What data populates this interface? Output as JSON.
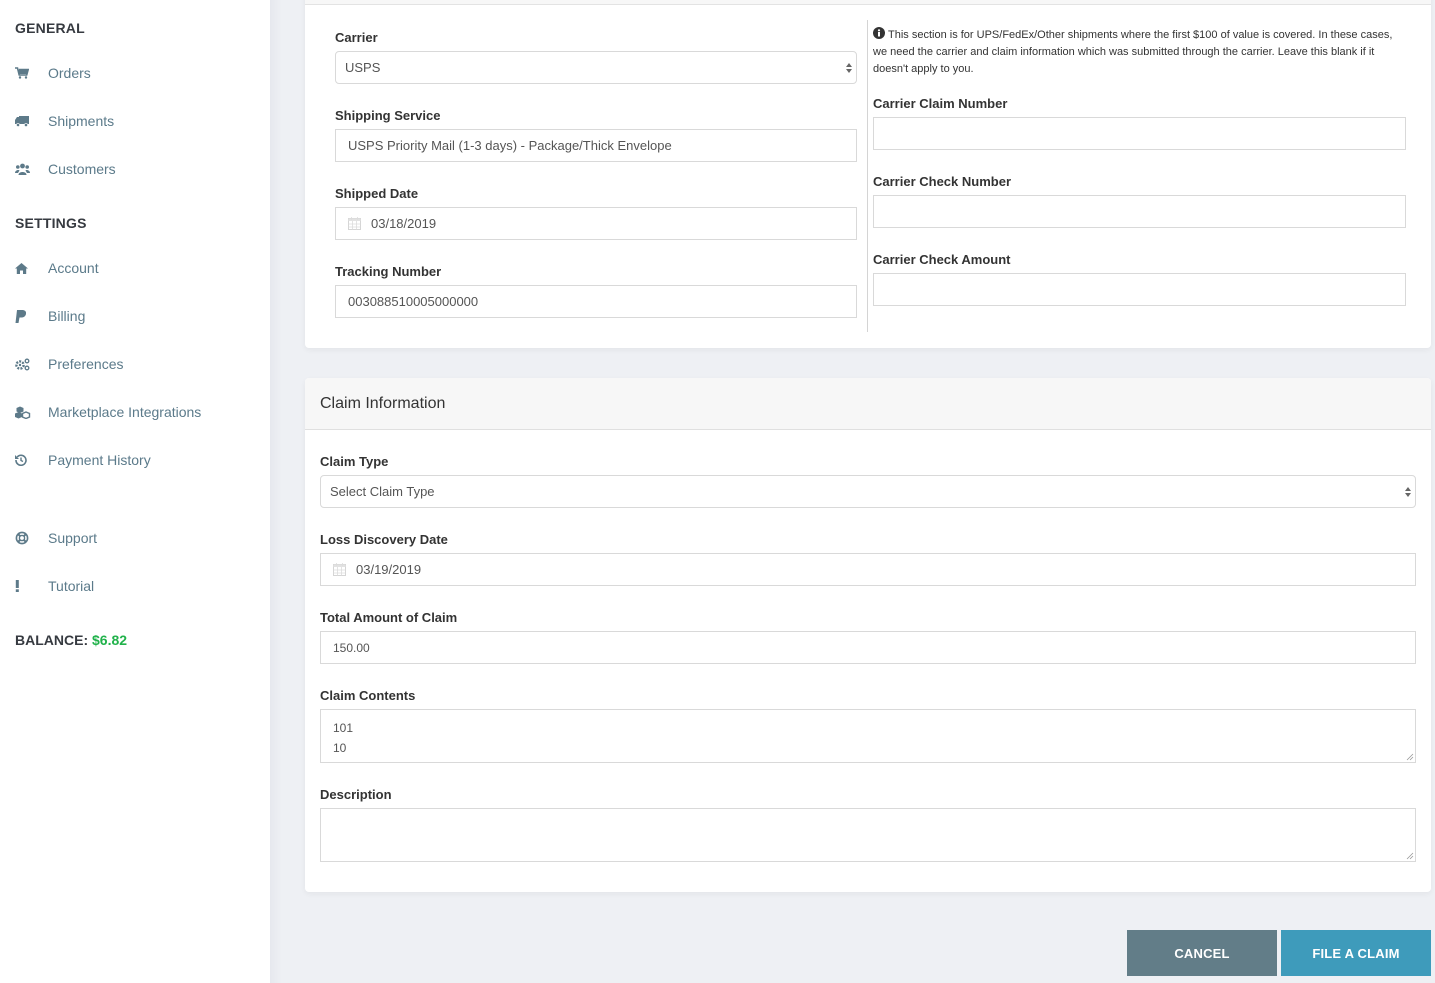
{
  "sidebar": {
    "general_heading": "GENERAL",
    "settings_heading": "SETTINGS",
    "general_items": [
      {
        "label": "Orders",
        "icon": "shopping-cart-icon"
      },
      {
        "label": "Shipments",
        "icon": "truck-icon"
      },
      {
        "label": "Customers",
        "icon": "users-icon"
      }
    ],
    "settings_items": [
      {
        "label": "Account",
        "icon": "home-icon"
      },
      {
        "label": "Billing",
        "icon": "paypal-icon"
      },
      {
        "label": "Preferences",
        "icon": "cogs-icon"
      },
      {
        "label": "Marketplace Integrations",
        "icon": "cubes-icon"
      },
      {
        "label": "Payment History",
        "icon": "history-icon"
      }
    ],
    "extra_items": [
      {
        "label": "Support",
        "icon": "life-ring-icon"
      },
      {
        "label": "Tutorial",
        "icon": "exclamation-icon"
      }
    ],
    "balance_label": "BALANCE:",
    "balance_value": "$6.82",
    "balance_color": "#21b24b"
  },
  "shipment": {
    "carrier": {
      "label": "Carrier",
      "value": "USPS"
    },
    "shipping_service": {
      "label": "Shipping Service",
      "value": "USPS Priority Mail (1-3 days) - Package/Thick Envelope"
    },
    "shipped_date": {
      "label": "Shipped Date",
      "value": "03/18/2019"
    },
    "tracking_number": {
      "label": "Tracking Number",
      "value": "003088510005000000"
    },
    "info_text": "This section is for UPS/FedEx/Other shipments where the first $100 of value is covered. In these cases, we need the carrier and claim information which was submitted through the carrier. Leave this blank if it doesn't apply to you.",
    "carrier_claim_number": {
      "label": "Carrier Claim Number",
      "value": ""
    },
    "carrier_check_number": {
      "label": "Carrier Check Number",
      "value": ""
    },
    "carrier_check_amount": {
      "label": "Carrier Check Amount",
      "value": ""
    }
  },
  "claim": {
    "title": "Claim Information",
    "claim_type": {
      "label": "Claim Type",
      "placeholder": "Select Claim Type"
    },
    "loss_discovery_date": {
      "label": "Loss Discovery Date",
      "value": "03/19/2019"
    },
    "total_amount": {
      "label": "Total Amount of Claim",
      "value": "150.00"
    },
    "claim_contents": {
      "label": "Claim Contents",
      "lines": [
        "101",
        "10"
      ]
    },
    "description": {
      "label": "Description",
      "value": ""
    }
  },
  "actions": {
    "cancel_label": "CANCEL",
    "file_label": "FILE A CLAIM",
    "cancel_color": "#627d88",
    "file_color": "#3e9bbb"
  }
}
